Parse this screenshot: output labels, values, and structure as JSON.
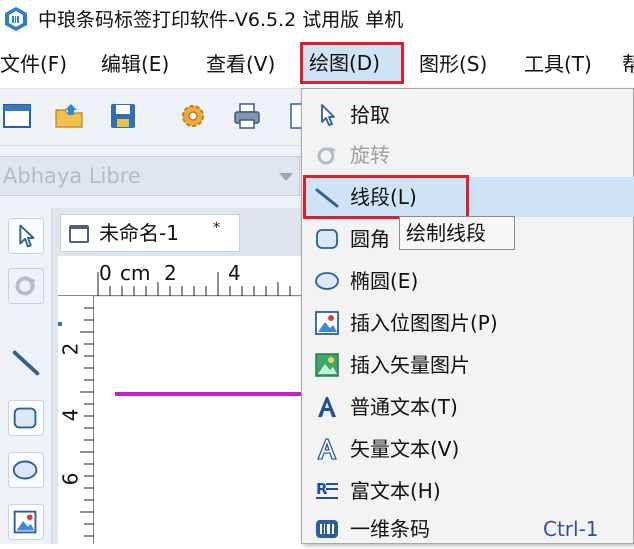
{
  "window": {
    "title": "中琅条码标签打印软件-V6.5.2 试用版 单机"
  },
  "menubar": {
    "items": [
      "文件(F)",
      "编辑(E)",
      "查看(V)",
      "绘图(D)",
      "图形(S)",
      "工具(T)",
      "帮"
    ],
    "active": "绘图(D)"
  },
  "font_bar": {
    "font_name": "Abhaya Libre"
  },
  "document": {
    "tab_title": "未命名-1",
    "tab_mark": "*"
  },
  "ruler": {
    "top_unit": "cm",
    "top_labels": [
      "0",
      "2",
      "4"
    ],
    "left_labels": [
      "2",
      "4",
      "6"
    ]
  },
  "draw_menu": {
    "items": [
      {
        "label": "拾取",
        "icon": "pointer-icon",
        "disabled": false
      },
      {
        "label": "旋转",
        "icon": "rotate-icon",
        "disabled": true
      },
      {
        "label": "线段(L)",
        "icon": "line-icon",
        "disabled": false,
        "highlighted": true
      },
      {
        "label": "圆角",
        "icon": "rounded-rect-icon",
        "disabled": false
      },
      {
        "label": "椭圆(E)",
        "icon": "ellipse-icon",
        "disabled": false
      },
      {
        "label": "插入位图图片(P)",
        "icon": "bitmap-image-icon",
        "disabled": false
      },
      {
        "label": "插入矢量图片",
        "icon": "vector-image-icon",
        "disabled": false
      },
      {
        "label": "普通文本(T)",
        "icon": "text-icon",
        "disabled": false
      },
      {
        "label": "矢量文本(V)",
        "icon": "vector-text-icon",
        "disabled": false
      },
      {
        "label": "富文本(H)",
        "icon": "rich-text-icon",
        "disabled": false
      },
      {
        "label": "一维条码",
        "icon": "barcode-icon",
        "disabled": false,
        "shortcut": "Ctrl-1"
      }
    ]
  },
  "tooltip": {
    "text": "绘制线段"
  },
  "colors": {
    "highlight_box": "#e01e2a",
    "menu_hover": "#cfe3f6",
    "drawn_line": "#d319d3"
  }
}
